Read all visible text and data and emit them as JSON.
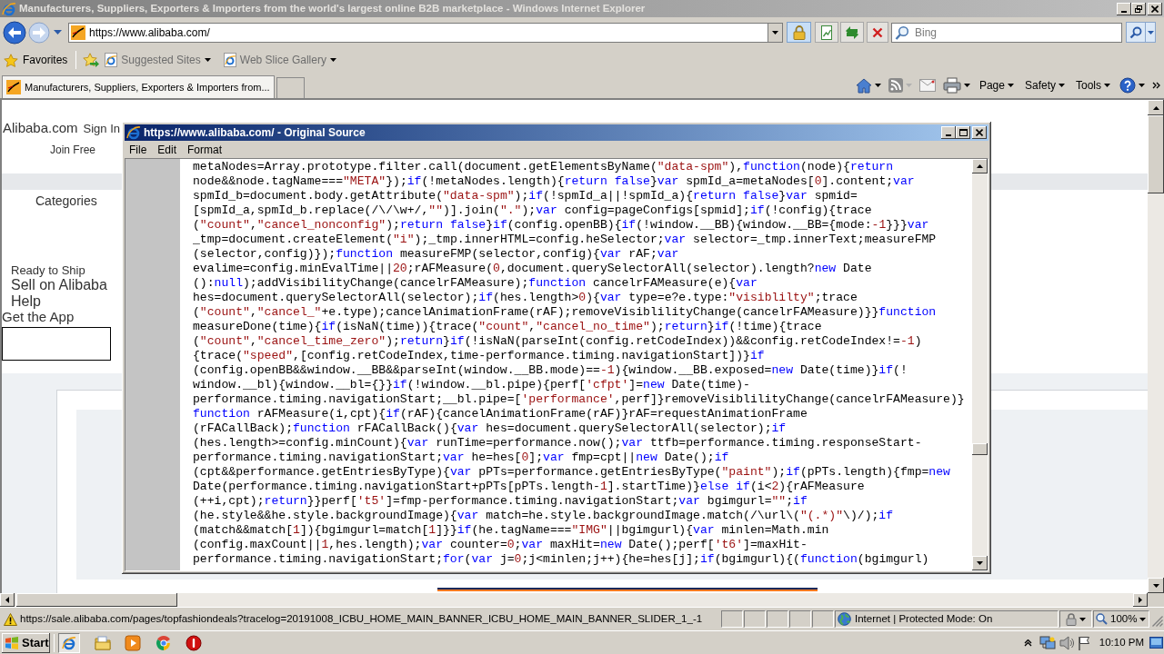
{
  "window": {
    "title": "Manufacturers, Suppliers, Exporters & Importers from the world's largest online B2B marketplace - Windows Internet Explorer",
    "active": false
  },
  "address_bar": {
    "url": "https://www.alibaba.com/"
  },
  "search_box": {
    "placeholder": "Bing"
  },
  "favorites_bar": {
    "favorites": "Favorites",
    "items": [
      {
        "label": "Suggested Sites"
      },
      {
        "label": "Web Slice Gallery"
      }
    ]
  },
  "tabs": [
    {
      "label": "Manufacturers, Suppliers, Exporters & Importers from...",
      "selected": true
    }
  ],
  "command_bar": {
    "menus": [
      {
        "label": "Page"
      },
      {
        "label": "Safety"
      },
      {
        "label": "Tools"
      }
    ]
  },
  "page": {
    "logo": "Alibaba.com",
    "sign_in": "Sign In",
    "join": "Join Free",
    "categories": "Categories",
    "links": [
      {
        "label": "Ready to Ship"
      },
      {
        "label": "Sell on Alibaba"
      },
      {
        "label": "Help"
      },
      {
        "label": "Get the App"
      }
    ]
  },
  "source_window": {
    "title": "https://www.alibaba.com/ - Original Source",
    "active": true,
    "menu": [
      {
        "label": "File"
      },
      {
        "label": "Edit"
      },
      {
        "label": "Format"
      }
    ],
    "lines": [
      [
        {
          "kind": "plain",
          "text": "metaNodes=Array.prototype.filter.call(document.getElementsByName("
        },
        {
          "kind": "literal",
          "text": "\"data-spm\""
        },
        {
          "kind": "plain",
          "text": "),"
        },
        {
          "kind": "keyword",
          "text": "function"
        },
        {
          "kind": "plain",
          "text": "(node){"
        },
        {
          "kind": "keyword",
          "text": "return"
        }
      ],
      [
        {
          "kind": "plain",
          "text": "node&&node.tagName==="
        },
        {
          "kind": "literal",
          "text": "\"META\""
        },
        {
          "kind": "plain",
          "text": "});"
        },
        {
          "kind": "keyword",
          "text": "if"
        },
        {
          "kind": "plain",
          "text": "(!metaNodes.length){"
        },
        {
          "kind": "keyword",
          "text": "return false"
        },
        {
          "kind": "plain",
          "text": "}"
        },
        {
          "kind": "keyword",
          "text": "var"
        },
        {
          "kind": "plain",
          "text": " spmId_a=metaNodes["
        },
        {
          "kind": "literal",
          "text": "0"
        },
        {
          "kind": "plain",
          "text": "].content;"
        },
        {
          "kind": "keyword",
          "text": "var"
        }
      ],
      [
        {
          "kind": "plain",
          "text": "spmId_b=document.body.getAttribute("
        },
        {
          "kind": "literal",
          "text": "\"data-spm\""
        },
        {
          "kind": "plain",
          "text": ");"
        },
        {
          "kind": "keyword",
          "text": "if"
        },
        {
          "kind": "plain",
          "text": "(!spmId_a||!spmId_a){"
        },
        {
          "kind": "keyword",
          "text": "return false"
        },
        {
          "kind": "plain",
          "text": "}"
        },
        {
          "kind": "keyword",
          "text": "var"
        },
        {
          "kind": "plain",
          "text": " spmid="
        }
      ],
      [
        {
          "kind": "plain",
          "text": "[spmId_a,spmId_b.replace(/\\/\\w+/,"
        },
        {
          "kind": "literal",
          "text": "\"\""
        },
        {
          "kind": "plain",
          "text": ")].join("
        },
        {
          "kind": "literal",
          "text": "\".\""
        },
        {
          "kind": "plain",
          "text": ");"
        },
        {
          "kind": "keyword",
          "text": "var"
        },
        {
          "kind": "plain",
          "text": " config=pageConfigs[spmid];"
        },
        {
          "kind": "keyword",
          "text": "if"
        },
        {
          "kind": "plain",
          "text": "(!config){trace"
        }
      ],
      [
        {
          "kind": "plain",
          "text": "("
        },
        {
          "kind": "literal",
          "text": "\"count\""
        },
        {
          "kind": "plain",
          "text": ","
        },
        {
          "kind": "literal",
          "text": "\"cancel_nonconfig\""
        },
        {
          "kind": "plain",
          "text": ");"
        },
        {
          "kind": "keyword",
          "text": "return false"
        },
        {
          "kind": "plain",
          "text": "}"
        },
        {
          "kind": "keyword",
          "text": "if"
        },
        {
          "kind": "plain",
          "text": "(config.openBB){"
        },
        {
          "kind": "keyword",
          "text": "if"
        },
        {
          "kind": "plain",
          "text": "(!window.__BB){window.__BB={mode:"
        },
        {
          "kind": "literal",
          "text": "-1"
        },
        {
          "kind": "plain",
          "text": "}}}"
        },
        {
          "kind": "keyword",
          "text": "var"
        }
      ],
      [
        {
          "kind": "plain",
          "text": "_tmp=document.createElement("
        },
        {
          "kind": "literal",
          "text": "\"i\""
        },
        {
          "kind": "plain",
          "text": ");_tmp.innerHTML=config.heSelector;"
        },
        {
          "kind": "keyword",
          "text": "var"
        },
        {
          "kind": "plain",
          "text": " selector=_tmp.innerText;measureFMP"
        }
      ],
      [
        {
          "kind": "plain",
          "text": "(selector,config)});"
        },
        {
          "kind": "keyword",
          "text": "function"
        },
        {
          "kind": "plain",
          "text": " measureFMP(selector,config){"
        },
        {
          "kind": "keyword",
          "text": "var"
        },
        {
          "kind": "plain",
          "text": " rAF;"
        },
        {
          "kind": "keyword",
          "text": "var"
        }
      ],
      [
        {
          "kind": "plain",
          "text": "evalime=config.minEvalTime||"
        },
        {
          "kind": "literal",
          "text": "20"
        },
        {
          "kind": "plain",
          "text": ";rAFMeasure("
        },
        {
          "kind": "literal",
          "text": "0"
        },
        {
          "kind": "plain",
          "text": ",document.querySelectorAll(selector).length?"
        },
        {
          "kind": "keyword",
          "text": "new"
        },
        {
          "kind": "plain",
          "text": " Date"
        }
      ],
      [
        {
          "kind": "plain",
          "text": "():"
        },
        {
          "kind": "keyword",
          "text": "null"
        },
        {
          "kind": "plain",
          "text": ");addVisibilityChange(cancelrFAMeasure);"
        },
        {
          "kind": "keyword",
          "text": "function"
        },
        {
          "kind": "plain",
          "text": " cancelrFAMeasure(e){"
        },
        {
          "kind": "keyword",
          "text": "var"
        }
      ],
      [
        {
          "kind": "plain",
          "text": "hes=document.querySelectorAll(selector);"
        },
        {
          "kind": "keyword",
          "text": "if"
        },
        {
          "kind": "plain",
          "text": "(hes.length>"
        },
        {
          "kind": "literal",
          "text": "0"
        },
        {
          "kind": "plain",
          "text": "){"
        },
        {
          "kind": "keyword",
          "text": "var"
        },
        {
          "kind": "plain",
          "text": " type=e?e.type:"
        },
        {
          "kind": "literal",
          "text": "\"visiblilty\""
        },
        {
          "kind": "plain",
          "text": ";trace"
        }
      ],
      [
        {
          "kind": "plain",
          "text": "("
        },
        {
          "kind": "literal",
          "text": "\"count\""
        },
        {
          "kind": "plain",
          "text": ","
        },
        {
          "kind": "literal",
          "text": "\"cancel_\""
        },
        {
          "kind": "plain",
          "text": "+e.type);cancelAnimationFrame(rAF);removeVisiblilityChange(cancelrFAMeasure)}}"
        },
        {
          "kind": "keyword",
          "text": "function"
        }
      ],
      [
        {
          "kind": "plain",
          "text": "measureDone(time){"
        },
        {
          "kind": "keyword",
          "text": "if"
        },
        {
          "kind": "plain",
          "text": "(isNaN(time)){trace("
        },
        {
          "kind": "literal",
          "text": "\"count\""
        },
        {
          "kind": "plain",
          "text": ","
        },
        {
          "kind": "literal",
          "text": "\"cancel_no_time\""
        },
        {
          "kind": "plain",
          "text": ");"
        },
        {
          "kind": "keyword",
          "text": "return"
        },
        {
          "kind": "plain",
          "text": "}"
        },
        {
          "kind": "keyword",
          "text": "if"
        },
        {
          "kind": "plain",
          "text": "(!time){trace"
        }
      ],
      [
        {
          "kind": "plain",
          "text": "("
        },
        {
          "kind": "literal",
          "text": "\"count\""
        },
        {
          "kind": "plain",
          "text": ","
        },
        {
          "kind": "literal",
          "text": "\"cancel_time_zero\""
        },
        {
          "kind": "plain",
          "text": ");"
        },
        {
          "kind": "keyword",
          "text": "return"
        },
        {
          "kind": "plain",
          "text": "}"
        },
        {
          "kind": "keyword",
          "text": "if"
        },
        {
          "kind": "plain",
          "text": "(!isNaN(parseInt(config.retCodeIndex))&&config.retCodeIndex!="
        },
        {
          "kind": "literal",
          "text": "-1"
        },
        {
          "kind": "plain",
          "text": ")"
        }
      ],
      [
        {
          "kind": "plain",
          "text": "{trace("
        },
        {
          "kind": "literal",
          "text": "\"speed\""
        },
        {
          "kind": "plain",
          "text": ",[config.retCodeIndex,time-performance.timing.navigationStart])}"
        },
        {
          "kind": "keyword",
          "text": "if"
        }
      ],
      [
        {
          "kind": "plain",
          "text": "(config.openBB&&window.__BB&&parseInt(window.__BB.mode)=="
        },
        {
          "kind": "literal",
          "text": "-1"
        },
        {
          "kind": "plain",
          "text": "){window.__BB.exposed="
        },
        {
          "kind": "keyword",
          "text": "new"
        },
        {
          "kind": "plain",
          "text": " Date(time)}"
        },
        {
          "kind": "keyword",
          "text": "if"
        },
        {
          "kind": "plain",
          "text": "(!"
        }
      ],
      [
        {
          "kind": "plain",
          "text": "window.__bl){window.__bl={}}"
        },
        {
          "kind": "keyword",
          "text": "if"
        },
        {
          "kind": "plain",
          "text": "(!window.__bl.pipe){perf["
        },
        {
          "kind": "literal",
          "text": "'cfpt'"
        },
        {
          "kind": "plain",
          "text": "]="
        },
        {
          "kind": "keyword",
          "text": "new"
        },
        {
          "kind": "plain",
          "text": " Date(time)-"
        }
      ],
      [
        {
          "kind": "plain",
          "text": "performance.timing.navigationStart;__bl.pipe=["
        },
        {
          "kind": "literal",
          "text": "'performance'"
        },
        {
          "kind": "plain",
          "text": ",perf]}removeVisiblilityChange(cancelrFAMeasure)}"
        }
      ],
      [
        {
          "kind": "keyword",
          "text": "function"
        },
        {
          "kind": "plain",
          "text": " rAFMeasure(i,cpt){"
        },
        {
          "kind": "keyword",
          "text": "if"
        },
        {
          "kind": "plain",
          "text": "(rAF){cancelAnimationFrame(rAF)}rAF=requestAnimationFrame"
        }
      ],
      [
        {
          "kind": "plain",
          "text": "(rFACallBack);"
        },
        {
          "kind": "keyword",
          "text": "function"
        },
        {
          "kind": "plain",
          "text": " rFACallBack(){"
        },
        {
          "kind": "keyword",
          "text": "var"
        },
        {
          "kind": "plain",
          "text": " hes=document.querySelectorAll(selector);"
        },
        {
          "kind": "keyword",
          "text": "if"
        }
      ],
      [
        {
          "kind": "plain",
          "text": "(hes.length>=config.minCount){"
        },
        {
          "kind": "keyword",
          "text": "var"
        },
        {
          "kind": "plain",
          "text": " runTime=performance.now();"
        },
        {
          "kind": "keyword",
          "text": "var"
        },
        {
          "kind": "plain",
          "text": " ttfb=performance.timing.responseStart-"
        }
      ],
      [
        {
          "kind": "plain",
          "text": "performance.timing.navigationStart;"
        },
        {
          "kind": "keyword",
          "text": "var"
        },
        {
          "kind": "plain",
          "text": " he=hes["
        },
        {
          "kind": "literal",
          "text": "0"
        },
        {
          "kind": "plain",
          "text": "];"
        },
        {
          "kind": "keyword",
          "text": "var"
        },
        {
          "kind": "plain",
          "text": " fmp=cpt||"
        },
        {
          "kind": "keyword",
          "text": "new"
        },
        {
          "kind": "plain",
          "text": " Date();"
        },
        {
          "kind": "keyword",
          "text": "if"
        }
      ],
      [
        {
          "kind": "plain",
          "text": "(cpt&&performance.getEntriesByType){"
        },
        {
          "kind": "keyword",
          "text": "var"
        },
        {
          "kind": "plain",
          "text": " pPTs=performance.getEntriesByType("
        },
        {
          "kind": "literal",
          "text": "\"paint\""
        },
        {
          "kind": "plain",
          "text": ");"
        },
        {
          "kind": "keyword",
          "text": "if"
        },
        {
          "kind": "plain",
          "text": "(pPTs.length){fmp="
        },
        {
          "kind": "keyword",
          "text": "new"
        }
      ],
      [
        {
          "kind": "plain",
          "text": "Date(performance.timing.navigationStart+pPTs[pPTs.length-"
        },
        {
          "kind": "literal",
          "text": "1"
        },
        {
          "kind": "plain",
          "text": "].startTime)}"
        },
        {
          "kind": "keyword",
          "text": "else if"
        },
        {
          "kind": "plain",
          "text": "(i<"
        },
        {
          "kind": "literal",
          "text": "2"
        },
        {
          "kind": "plain",
          "text": "){rAFMeasure"
        }
      ],
      [
        {
          "kind": "plain",
          "text": "(++i,cpt);"
        },
        {
          "kind": "keyword",
          "text": "return"
        },
        {
          "kind": "plain",
          "text": "}}perf["
        },
        {
          "kind": "literal",
          "text": "'t5'"
        },
        {
          "kind": "plain",
          "text": "]=fmp-performance.timing.navigationStart;"
        },
        {
          "kind": "keyword",
          "text": "var"
        },
        {
          "kind": "plain",
          "text": " bgimgurl="
        },
        {
          "kind": "literal",
          "text": "\"\""
        },
        {
          "kind": "plain",
          "text": ";"
        },
        {
          "kind": "keyword",
          "text": "if"
        }
      ],
      [
        {
          "kind": "plain",
          "text": "(he.style&&he.style.backgroundImage){"
        },
        {
          "kind": "keyword",
          "text": "var"
        },
        {
          "kind": "plain",
          "text": " match=he.style.backgroundImage.match(/\\url\\("
        },
        {
          "kind": "literal",
          "text": "\"(.*)\""
        },
        {
          "kind": "plain",
          "text": "\\)/);"
        },
        {
          "kind": "keyword",
          "text": "if"
        }
      ],
      [
        {
          "kind": "plain",
          "text": "(match&&match["
        },
        {
          "kind": "literal",
          "text": "1"
        },
        {
          "kind": "plain",
          "text": "]){bgimgurl=match["
        },
        {
          "kind": "literal",
          "text": "1"
        },
        {
          "kind": "plain",
          "text": "]}}"
        },
        {
          "kind": "keyword",
          "text": "if"
        },
        {
          "kind": "plain",
          "text": "(he.tagName==="
        },
        {
          "kind": "literal",
          "text": "\"IMG\""
        },
        {
          "kind": "plain",
          "text": "||bgimgurl){"
        },
        {
          "kind": "keyword",
          "text": "var"
        },
        {
          "kind": "plain",
          "text": " minlen=Math.min"
        }
      ],
      [
        {
          "kind": "plain",
          "text": "(config.maxCount||"
        },
        {
          "kind": "literal",
          "text": "1"
        },
        {
          "kind": "plain",
          "text": ",hes.length);"
        },
        {
          "kind": "keyword",
          "text": "var"
        },
        {
          "kind": "plain",
          "text": " counter="
        },
        {
          "kind": "literal",
          "text": "0"
        },
        {
          "kind": "plain",
          "text": ";"
        },
        {
          "kind": "keyword",
          "text": "var"
        },
        {
          "kind": "plain",
          "text": " maxHit="
        },
        {
          "kind": "keyword",
          "text": "new"
        },
        {
          "kind": "plain",
          "text": " Date();perf["
        },
        {
          "kind": "literal",
          "text": "'t6'"
        },
        {
          "kind": "plain",
          "text": "]=maxHit-"
        }
      ],
      [
        {
          "kind": "plain",
          "text": "performance.timing.navigationStart;"
        },
        {
          "kind": "keyword",
          "text": "for"
        },
        {
          "kind": "plain",
          "text": "("
        },
        {
          "kind": "keyword",
          "text": "var"
        },
        {
          "kind": "plain",
          "text": " j="
        },
        {
          "kind": "literal",
          "text": "0"
        },
        {
          "kind": "plain",
          "text": ";j<minlen;j++){he=hes[j];"
        },
        {
          "kind": "keyword",
          "text": "if"
        },
        {
          "kind": "plain",
          "text": "(bgimgurl){("
        },
        {
          "kind": "keyword",
          "text": "function"
        },
        {
          "kind": "plain",
          "text": "(bgimgurl)"
        }
      ]
    ]
  },
  "status_bar": {
    "url": "https://sale.alibaba.com/pages/topfashiondeals?tracelog=20191008_ICBU_HOME_MAIN_BANNER_ICBU_HOME_MAIN_BANNER_SLIDER_1_-1",
    "zone": "Internet | Protected Mode: On",
    "zoom": "100%"
  },
  "taskbar": {
    "start": "Start",
    "clock": "10:10 PM"
  }
}
